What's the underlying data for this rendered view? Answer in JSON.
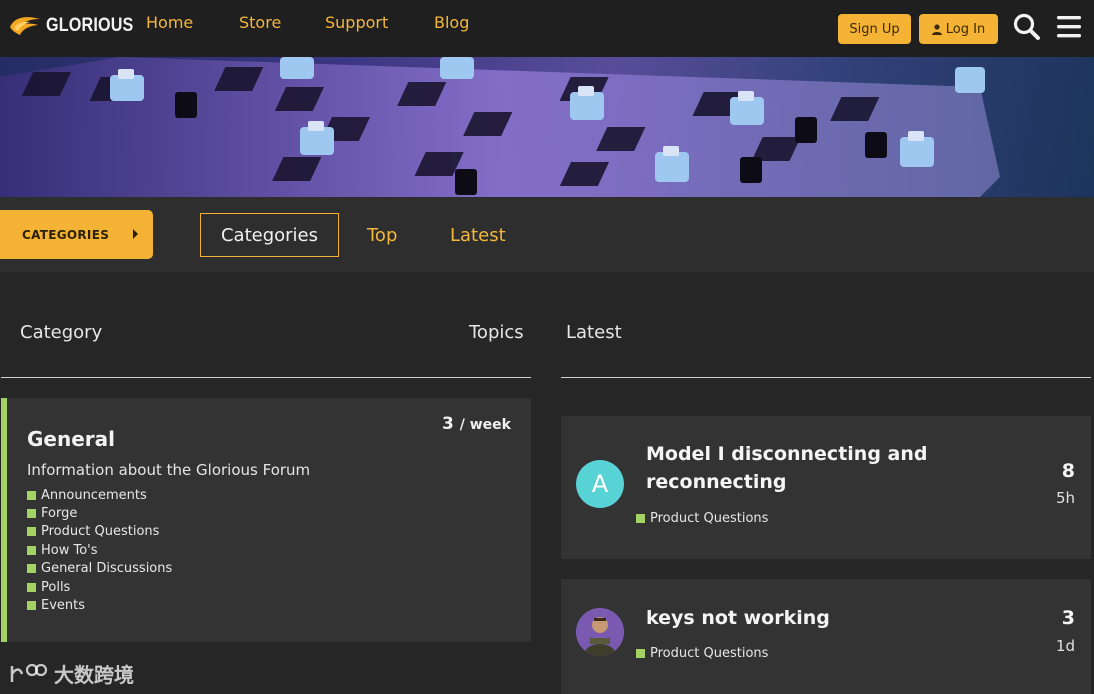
{
  "header": {
    "logo_text": "GLORIOUS",
    "nav": [
      "Home",
      "Store",
      "Support",
      "Blog"
    ],
    "signup_label": "Sign Up",
    "login_label": "Log In",
    "brand_color": "#f5b335"
  },
  "subnav": {
    "categories_button": "CATEGORIES",
    "tabs": [
      "Categories",
      "Top",
      "Latest"
    ]
  },
  "table": {
    "col_category": "Category",
    "col_topics": "Topics",
    "col_latest": "Latest"
  },
  "category": {
    "title": "General",
    "description": "Information about the Glorious Forum",
    "rate_value": "3",
    "rate_unit": "/ week",
    "accent_color": "#a4d263",
    "subcategories": [
      "Announcements",
      "Forge",
      "Product Questions",
      "How To's",
      "General Discussions",
      "Polls",
      "Events"
    ]
  },
  "topics": [
    {
      "avatar_letter": "A",
      "avatar_color": "#57d3d6",
      "title": "Model I disconnecting and reconnecting",
      "category": "Product Questions",
      "posts": "8",
      "age": "5h"
    },
    {
      "avatar_icon": "user-photo",
      "title": "keys not working",
      "category": "Product Questions",
      "posts": "3",
      "age": "1d"
    }
  ],
  "watermark": "大数跨境"
}
